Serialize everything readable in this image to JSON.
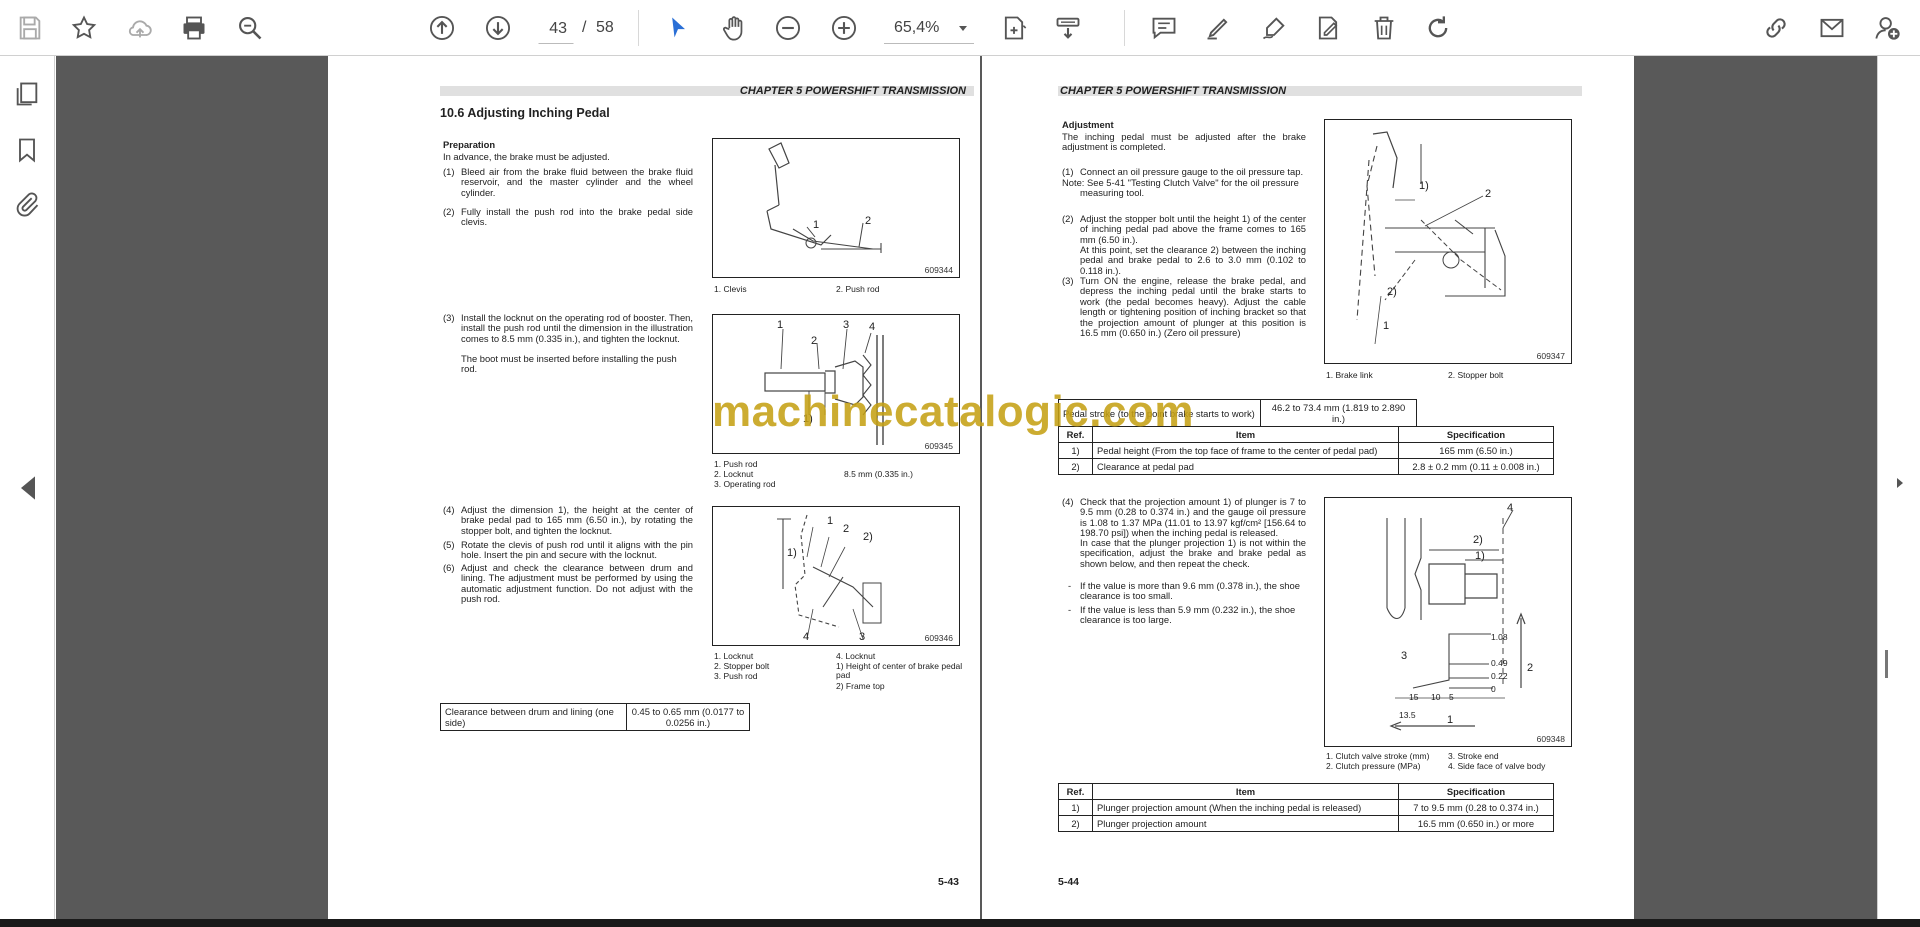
{
  "toolbar": {
    "page_current": "43",
    "page_separator": "/",
    "page_total": "58",
    "zoom": "65,4%"
  },
  "pages": {
    "left": {
      "header": "CHAPTER 5 POWERSHIFT TRANSMISSION",
      "section": "10.6    Adjusting Inching Pedal",
      "prep_title": "Preparation",
      "prep_text": "In advance, the brake must be adjusted.",
      "step1_num": "(1)",
      "step1": "Bleed air from the brake fluid between the brake fluid reservoir, and the master cylinder and the wheel cylinder.",
      "step2_num": "(2)",
      "step2": "Fully install the push rod into the brake pedal side clevis.",
      "step3_num": "(3)",
      "step3": "Install the locknut on the operating rod of booster. Then, install the push rod until the dimension in the illustration comes to 8.5 mm (0.335 in.), and tighten the locknut.",
      "step3b": "The boot must be inserted before installing the push rod.",
      "step4_num": "(4)",
      "step4": "Adjust the dimension 1), the height at the center of brake pedal pad to 165 mm (6.50 in.), by rotating the stopper bolt, and tighten the locknut.",
      "step5_num": "(5)",
      "step5": "Rotate the clevis of push rod until it aligns with the pin hole. Insert the pin and secure with the locknut.",
      "step6_num": "(6)",
      "step6": "Adjust and check the clearance between drum and lining. The adjustment must be performed by using the automatic adjustment function. Do not adjust with the push rod.",
      "fig1": {
        "num": "609344",
        "cap1": "1. Clevis",
        "cap2": "2. Push rod",
        "l1": "1",
        "l2": "2"
      },
      "fig2": {
        "num": "609345",
        "cap": [
          "1. Push rod",
          "2. Locknut",
          "3. Operating rod"
        ],
        "cap_dim": "8.5 mm (0.335 in.)",
        "l1": "1",
        "l2": "2",
        "l3": "3",
        "l4": "4",
        "l5": "1)"
      },
      "fig3": {
        "num": "609346",
        "capL": [
          "1. Locknut",
          "2. Stopper bolt",
          "3. Push rod"
        ],
        "capR": [
          "4. Locknut",
          "1) Height of center of brake pedal",
          "    pad",
          "2) Frame top"
        ],
        "l1": "1",
        "l2": "2",
        "l3": "2)",
        "l4": "1)",
        "l5": "4",
        "l6": "3"
      },
      "clearance_label": "Clearance between drum and lining (one side)",
      "clearance_value": "0.45 to 0.65 mm (0.0177 to 0.0256 in.)",
      "footer": "5-43"
    },
    "right": {
      "header": "CHAPTER 5 POWERSHIFT TRANSMISSION",
      "adj_title": "Adjustment",
      "adj_text": "The inching pedal must be adjusted after the brake adjustment is completed.",
      "s1_num": "(1)",
      "s1": "Connect an oil pressure gauge to the oil pressure tap.",
      "note": "Note: See 5-41 \"Testing Clutch Valve\" for the oil pressure",
      "note2": "measuring tool.",
      "s2_num": "(2)",
      "s2": "Adjust the stopper bolt until the height 1) of the center of inching pedal pad above the frame comes to 165 mm (6.50 in.).",
      "s2b": "At this point, set the clearance 2) between the inching pedal and brake pedal to 2.6 to 3.0 mm (0.102 to 0.118 in.).",
      "s3_num": "(3)",
      "s3": "Turn ON the engine, release the brake pedal, and depress the inching pedal until the brake starts to work (the pedal becomes heavy). Adjust the cable length or tightening position of inching bracket so that the projection amount of plunger at this position is 16.5 mm (0.650 in.) (Zero oil pressure)",
      "fig4": {
        "num": "609347",
        "cap1": "1. Brake link",
        "cap2": "2. Stopper bolt",
        "l1": "1)",
        "l2": "2",
        "l3": "2)",
        "l4": "1"
      },
      "pedal_stroke_label": "Pedal stroke (to the point brake starts to work)",
      "pedal_stroke_value": "46.2 to 73.4 mm (1.819 to 2.890 in.)",
      "table1": {
        "headers": [
          "Ref.",
          "Item",
          "Specification"
        ],
        "rows": [
          [
            "1)",
            "Pedal height (From the top face of frame to the center of pedal pad)",
            "165 mm (6.50 in.)"
          ],
          [
            "2)",
            "Clearance at pedal pad",
            "2.8 ± 0.2 mm (0.11 ± 0.008 in.)"
          ]
        ]
      },
      "s4_num": "(4)",
      "s4": "Check that the projection amount 1) of plunger is 7 to 9.5 mm (0.28 to 0.374 in.) and the gauge oil pressure is 1.08 to 1.37 MPa (11.01 to 13.97 kgf/cm² [156.64 to 198.70 psi]) when the inching pedal is released.",
      "s4b": "In case that the plunger projection 1) is not within the specification, adjust the brake and brake pedal as shown below, and then repeat the check.",
      "bullet1": "If the value is more than 9.6 mm (0.378 in.), the shoe clearance is too small.",
      "bullet2": "If the value is less than 5.9 mm (0.232 in.), the shoe clearance is too large.",
      "fig5": {
        "num": "609348",
        "capL": [
          "1. Clutch valve stroke (mm)",
          "2. Clutch pressure (MPa)"
        ],
        "capR": [
          "3. Stroke end",
          "4. Side face of valve body"
        ],
        "l4": "4",
        "l2p": "2)",
        "l1p": "1)",
        "v108": "1.08",
        "v049": "0.49",
        "v022": "0.22",
        "v0": "0",
        "l3": "3",
        "l2": "2",
        "x15": "15",
        "x10": "10",
        "x5": "5",
        "x135": "13.5",
        "l1": "1"
      },
      "table2": {
        "headers": [
          "Ref.",
          "Item",
          "Specification"
        ],
        "rows": [
          [
            "1)",
            "Plunger projection amount (When the inching pedal is released)",
            "7 to 9.5 mm (0.28 to 0.374 in.)"
          ],
          [
            "2)",
            "Plunger projection amount",
            "16.5 mm (0.650 in.) or more"
          ]
        ]
      },
      "footer": "5-44"
    }
  },
  "watermark": "machinecatalogic.com"
}
